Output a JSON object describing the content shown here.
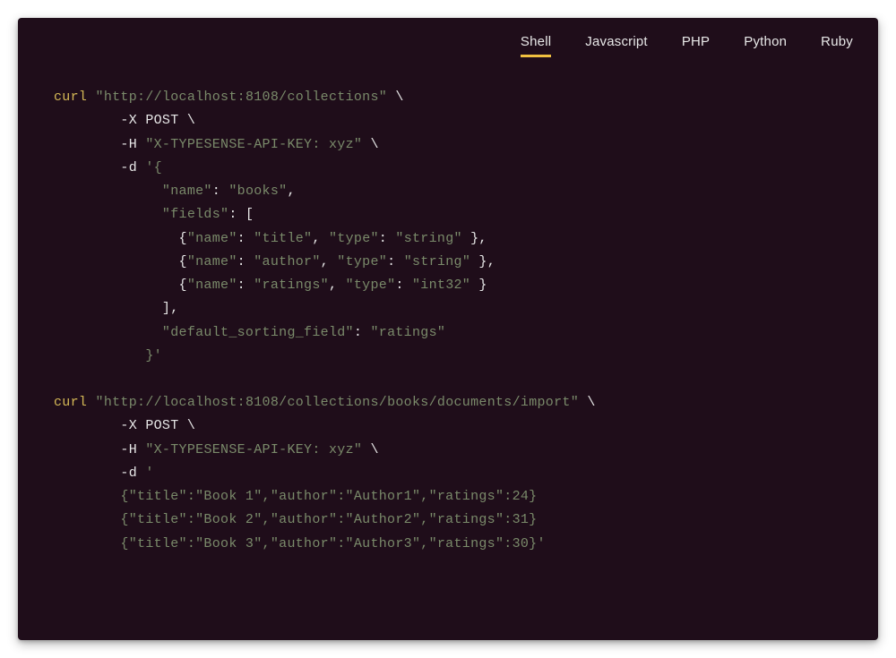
{
  "tabs": [
    {
      "label": "Shell",
      "active": true
    },
    {
      "label": "Javascript",
      "active": false
    },
    {
      "label": "PHP",
      "active": false
    },
    {
      "label": "Python",
      "active": false
    },
    {
      "label": "Ruby",
      "active": false
    }
  ],
  "code": {
    "block1": {
      "cmd": "curl",
      "url": "\"http://localhost:8108/collections\"",
      "backslash": " \\",
      "l2": "        -X POST \\",
      "l3p": "        -H ",
      "l3v": "\"X-TYPESENSE-API-KEY: xyz\"",
      "l4p": "        -d ",
      "l4v": "'{",
      "l5k": "             \"name\"",
      "l5c": ": ",
      "l5v": "\"books\"",
      "l5e": ",",
      "l6k": "             \"fields\"",
      "l6c": ": [",
      "l7a": "               {",
      "l7b": "\"name\"",
      "l7c": ": ",
      "l7d": "\"title\"",
      "l7e": ", ",
      "l7f": "\"type\"",
      "l7g": ": ",
      "l7h": "\"string\"",
      "l7i": " },",
      "l8a": "               {",
      "l8b": "\"name\"",
      "l8c": ": ",
      "l8d": "\"author\"",
      "l8e": ", ",
      "l8f": "\"type\"",
      "l8g": ": ",
      "l8h": "\"string\"",
      "l8i": " },",
      "l9a": "               {",
      "l9b": "\"name\"",
      "l9c": ": ",
      "l9d": "\"ratings\"",
      "l9e": ", ",
      "l9f": "\"type\"",
      "l9g": ": ",
      "l9h": "\"int32\"",
      "l9i": " }",
      "l10": "             ],",
      "l11k": "             \"default_sorting_field\"",
      "l11c": ": ",
      "l11v": "\"ratings\"",
      "l12": "           }'"
    },
    "block2": {
      "cmd": "curl",
      "url": "\"http://localhost:8108/collections/books/documents/import\"",
      "backslash": " \\",
      "l2": "        -X POST \\",
      "l3p": "        -H ",
      "l3v": "\"X-TYPESENSE-API-KEY: xyz\"",
      "l4p": "        -d ",
      "l4v": "'",
      "l5": "        {\"title\":\"Book 1\",\"author\":\"Author1\",\"ratings\":24}",
      "l6": "        {\"title\":\"Book 2\",\"author\":\"Author2\",\"ratings\":31}",
      "l7": "        {\"title\":\"Book 3\",\"author\":\"Author3\",\"ratings\":30}'"
    }
  }
}
